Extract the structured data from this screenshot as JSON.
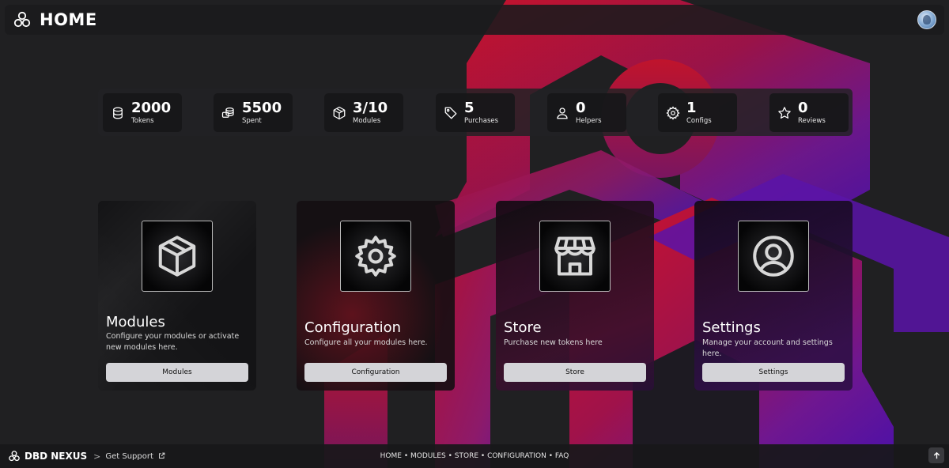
{
  "header": {
    "title": "HOME",
    "logo_icon": "nexus-logo-icon",
    "avatar_icon": "user-avatar"
  },
  "stats": [
    {
      "value": "2000",
      "label": "Tokens",
      "icon": "coins-icon"
    },
    {
      "value": "5500",
      "label": "Spent",
      "icon": "money-stack-icon"
    },
    {
      "value": "3/10",
      "label": "Modules",
      "icon": "box-icon"
    },
    {
      "value": "5",
      "label": "Purchases",
      "icon": "tag-icon"
    },
    {
      "value": "0",
      "label": "Helpers",
      "icon": "user-icon"
    },
    {
      "value": "1",
      "label": "Configs",
      "icon": "gear-icon"
    },
    {
      "value": "0",
      "label": "Reviews",
      "icon": "star-icon"
    }
  ],
  "cards": [
    {
      "title": "Modules",
      "description": "Configure your modules or activate new modules here.",
      "button": "Modules",
      "icon": "box-icon"
    },
    {
      "title": "Configuration",
      "description": "Configure all your modules here.",
      "button": "Configuration",
      "icon": "gear-icon"
    },
    {
      "title": "Store",
      "description": "Purchase new tokens here",
      "button": "Store",
      "icon": "store-icon"
    },
    {
      "title": "Settings",
      "description": "Manage your account and settings here.",
      "button": "Settings",
      "icon": "user-circle-icon"
    }
  ],
  "footer": {
    "brand": "DBD NEXUS",
    "separator": ">",
    "support": "Get Support",
    "links": [
      "HOME",
      "MODULES",
      "STORE",
      "CONFIGURATION",
      "FAQ"
    ],
    "links_separator": " • ",
    "scroll_top_icon": "arrow-up-icon"
  },
  "colors": {
    "background": "#202022",
    "accent_red": "#c0132a",
    "accent_magenta": "#8a1f6e",
    "accent_purple": "#5a14a8",
    "button_bg": "#d4d4d8"
  }
}
